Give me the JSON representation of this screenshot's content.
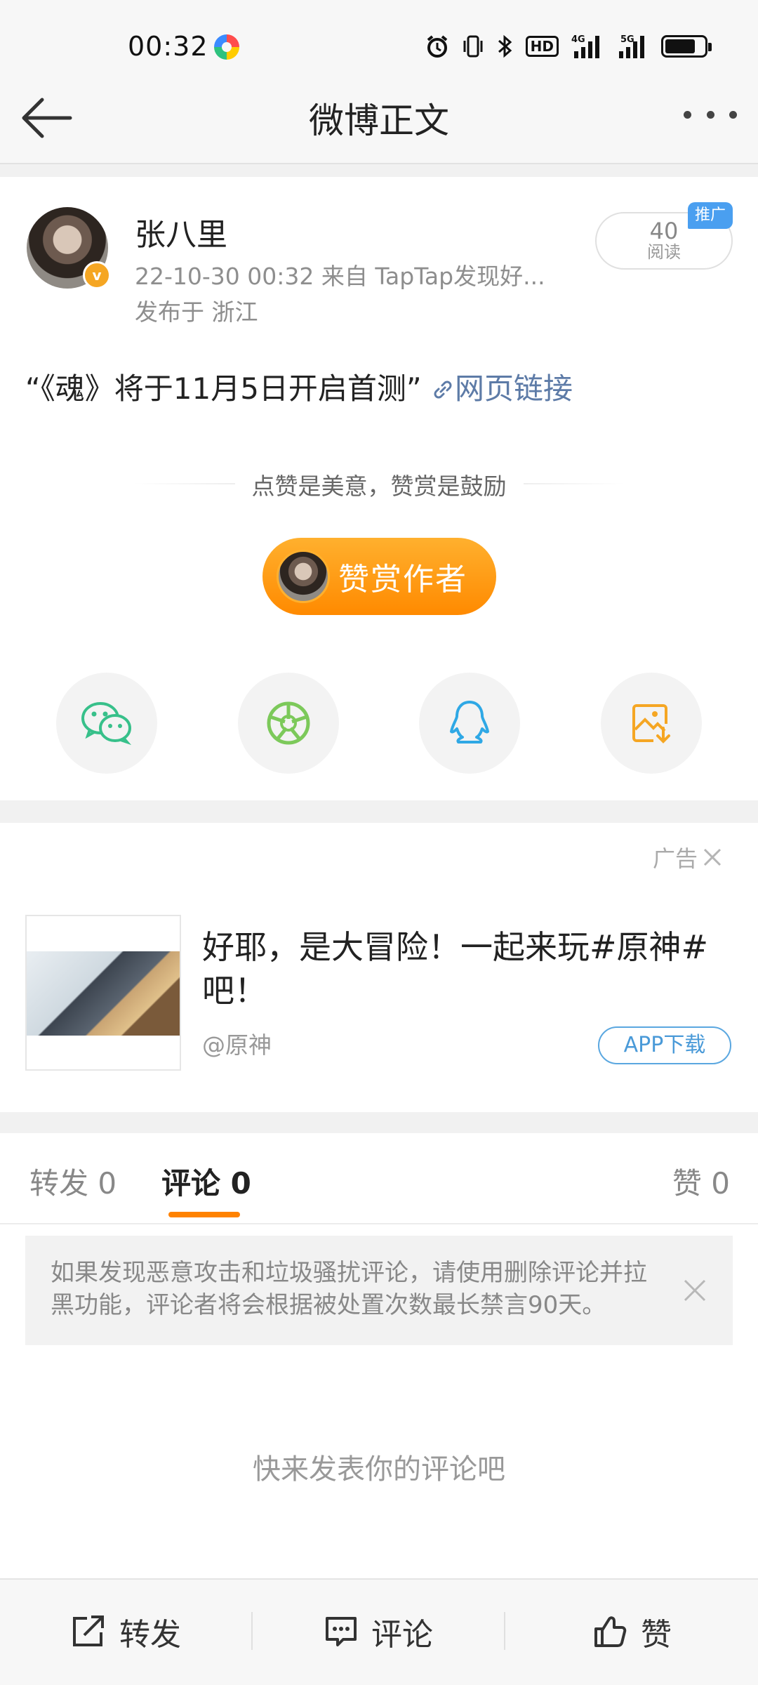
{
  "status_bar": {
    "time": "00:32",
    "hd_label": "HD",
    "net_4g": "4G",
    "net_5g": "5G"
  },
  "nav": {
    "title": "微博正文"
  },
  "post": {
    "author": "张八里",
    "meta": "22-10-30 00:32   来自 TapTap发现好...",
    "location": "发布于 浙江",
    "reads_count": "40",
    "reads_label": "阅读",
    "promo_badge": "推广",
    "text": "“《魂》将于11月5日开启首测”",
    "link_text": "网页链接",
    "praise_hint": "点赞是美意，赞赏是鼓励",
    "reward_label": "赞赏作者"
  },
  "share": {
    "items": [
      {
        "icon": "wechat-icon",
        "color": "#37c08a"
      },
      {
        "icon": "moments-icon",
        "color": "#7cc95a"
      },
      {
        "icon": "qq-icon",
        "color": "#2fa8e5"
      },
      {
        "icon": "save-image-icon",
        "color": "#f5a623"
      }
    ]
  },
  "ad": {
    "tag": "广告",
    "title": "好耶，是大冒险！一起来玩#原神#吧！",
    "handle": "@原神",
    "button": "APP下载"
  },
  "comments": {
    "tab_repost": "转发 0",
    "tab_comment": "评论 0",
    "tab_like": "赞 0",
    "notice": "如果发现恶意攻击和垃圾骚扰评论，请使用删除评论并拉黑功能，评论者将会根据被处置次数最长禁言90天。",
    "empty": "快来发表你的评论吧"
  },
  "bottom_bar": {
    "repost": "转发",
    "comment": "评论",
    "like": "赞"
  },
  "colors": {
    "accent": "#ff8200",
    "link": "#5d7ba7",
    "promo": "#4a9ff0"
  }
}
